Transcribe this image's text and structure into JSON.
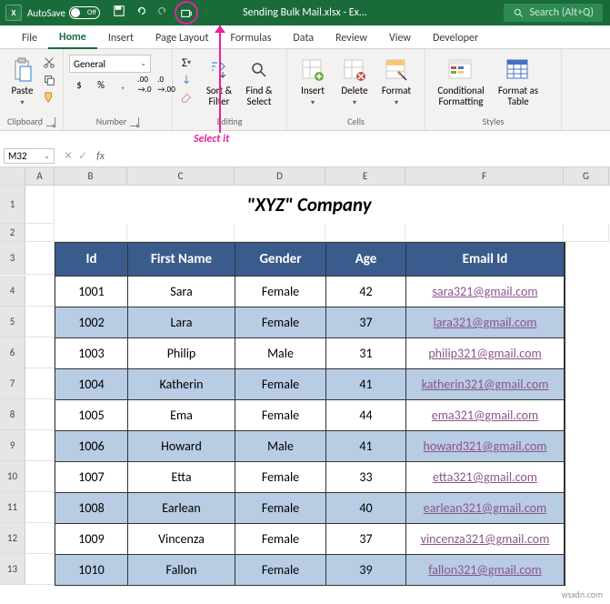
{
  "titlebar": {
    "autosave": "AutoSave",
    "autosave_state": "Off",
    "filename": "Sending Bulk Mail.xlsx",
    "app_suffix": " - Ex...",
    "search_placeholder": "Search (Alt+Q)"
  },
  "tabs": [
    "File",
    "Home",
    "Insert",
    "Page Layout",
    "Formulas",
    "Data",
    "Review",
    "View",
    "Developer"
  ],
  "active_tab": "Home",
  "ribbon": {
    "clipboard": {
      "label": "Clipboard",
      "paste": "Paste"
    },
    "number": {
      "label": "Number",
      "format": "General",
      "btns": [
        "$",
        "%",
        ",",
        "←.0",
        "→.0"
      ]
    },
    "editing": {
      "label": "Editing",
      "sort": "Sort &\nFilter",
      "find": "Find &\nSelect"
    },
    "cells": {
      "label": "Cells",
      "insert": "Insert",
      "delete": "Delete",
      "format": "Format"
    },
    "styles": {
      "label": "Styles",
      "cond": "Conditional\nFormatting",
      "tbl": "Format as\nTable"
    }
  },
  "annotation": "Select it",
  "namebox": "M32",
  "fx": "fx",
  "columns": [
    "A",
    "B",
    "C",
    "D",
    "E",
    "F",
    "G"
  ],
  "company_title": "\"XYZ\" Company",
  "table_headers": [
    "Id",
    "First Name",
    "Gender",
    "Age",
    "Email Id"
  ],
  "chart_data": {
    "type": "table",
    "columns": [
      "Id",
      "First Name",
      "Gender",
      "Age",
      "Email Id"
    ],
    "rows": [
      {
        "id": "1001",
        "first": "Sara",
        "gender": "Female",
        "age": "42",
        "email": "sara321@gmail.com"
      },
      {
        "id": "1002",
        "first": "Lara",
        "gender": "Female",
        "age": "37",
        "email": "lara321@gmail.com"
      },
      {
        "id": "1003",
        "first": "Philip",
        "gender": "Male",
        "age": "31",
        "email": "philip321@gmail.com"
      },
      {
        "id": "1004",
        "first": "Katherin",
        "gender": "Female",
        "age": "41",
        "email": "katherin321@gmail.com"
      },
      {
        "id": "1005",
        "first": "Ema",
        "gender": "Female",
        "age": "44",
        "email": "ema321@gmail.com"
      },
      {
        "id": "1006",
        "first": "Howard",
        "gender": "Male",
        "age": "41",
        "email": "howard321@gmail.com"
      },
      {
        "id": "1007",
        "first": "Etta",
        "gender": "Female",
        "age": "33",
        "email": "etta321@gmail.com"
      },
      {
        "id": "1008",
        "first": "Earlean",
        "gender": "Female",
        "age": "40",
        "email": "earlean321@gmail.com"
      },
      {
        "id": "1009",
        "first": "Vincenza",
        "gender": "Female",
        "age": "37",
        "email": "vincenza321@gmail.com"
      },
      {
        "id": "1010",
        "first": "Fallon",
        "gender": "Female",
        "age": "39",
        "email": "fallon321@gmail.com"
      }
    ]
  },
  "row_numbers": [
    "1",
    "2",
    "3",
    "4",
    "5",
    "6",
    "7",
    "8",
    "9",
    "10",
    "11",
    "12",
    "13"
  ],
  "watermark": "wsxdn.com"
}
